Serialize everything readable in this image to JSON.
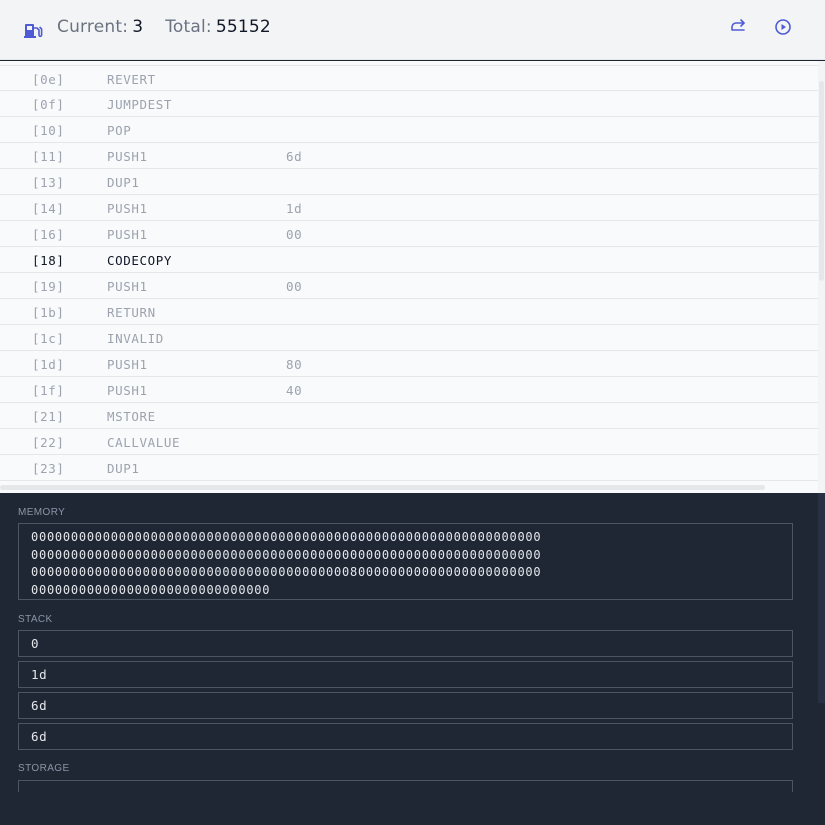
{
  "header": {
    "current_label": "Current:",
    "current_value": "3",
    "total_label": "Total:",
    "total_value": "55152",
    "icons": {
      "gas": "gas-pump-icon",
      "redo": "redo-icon",
      "play": "play-circle-icon"
    },
    "accent": "#4f5bd5"
  },
  "instructions": [
    {
      "addr": "[0e]",
      "op": "REVERT",
      "arg": ""
    },
    {
      "addr": "[0f]",
      "op": "JUMPDEST",
      "arg": ""
    },
    {
      "addr": "[10]",
      "op": "POP",
      "arg": ""
    },
    {
      "addr": "[11]",
      "op": "PUSH1",
      "arg": "6d"
    },
    {
      "addr": "[13]",
      "op": "DUP1",
      "arg": ""
    },
    {
      "addr": "[14]",
      "op": "PUSH1",
      "arg": "1d"
    },
    {
      "addr": "[16]",
      "op": "PUSH1",
      "arg": "00"
    },
    {
      "addr": "[18]",
      "op": "CODECOPY",
      "arg": "",
      "active": true
    },
    {
      "addr": "[19]",
      "op": "PUSH1",
      "arg": "00"
    },
    {
      "addr": "[1b]",
      "op": "RETURN",
      "arg": ""
    },
    {
      "addr": "[1c]",
      "op": "INVALID",
      "arg": ""
    },
    {
      "addr": "[1d]",
      "op": "PUSH1",
      "arg": "80"
    },
    {
      "addr": "[1f]",
      "op": "PUSH1",
      "arg": "40"
    },
    {
      "addr": "[21]",
      "op": "MSTORE",
      "arg": ""
    },
    {
      "addr": "[22]",
      "op": "CALLVALUE",
      "arg": ""
    },
    {
      "addr": "[23]",
      "op": "DUP1",
      "arg": ""
    }
  ],
  "memory": {
    "label": "MEMORY",
    "lines": [
      "0000000000000000000000000000000000000000000000000000000000000000",
      "0000000000000000000000000000000000000000000000000000000000000000",
      "0000000000000000000000000000000000000000800000000000000000000000",
      "000000000000000000000000000000"
    ]
  },
  "stack": {
    "label": "STACK",
    "items": [
      "0",
      "1d",
      "6d",
      "6d"
    ]
  },
  "storage": {
    "label": "STORAGE"
  }
}
